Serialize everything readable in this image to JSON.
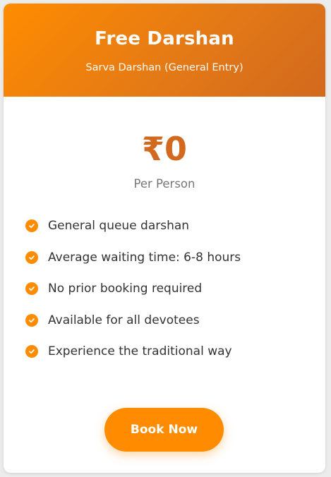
{
  "card": {
    "title": "Free Darshan",
    "subtitle": "Sarva Darshan (General Entry)",
    "price": "₹0",
    "period": "Per Person",
    "features": [
      {
        "label": "General queue darshan",
        "icon": "check-circle-icon"
      },
      {
        "label": "Average waiting time: 6-8 hours",
        "icon": "check-circle-icon"
      },
      {
        "label": "No prior booking required",
        "icon": "check-circle-icon"
      },
      {
        "label": "Available for all devotees",
        "icon": "check-circle-icon"
      },
      {
        "label": "Experience the traditional way",
        "icon": "check-circle-icon"
      }
    ],
    "button_label": "Book Now"
  },
  "colors": {
    "accent": "#ff8c00",
    "accent_dark": "#d2691e",
    "text": "#333333",
    "muted": "#777777"
  }
}
